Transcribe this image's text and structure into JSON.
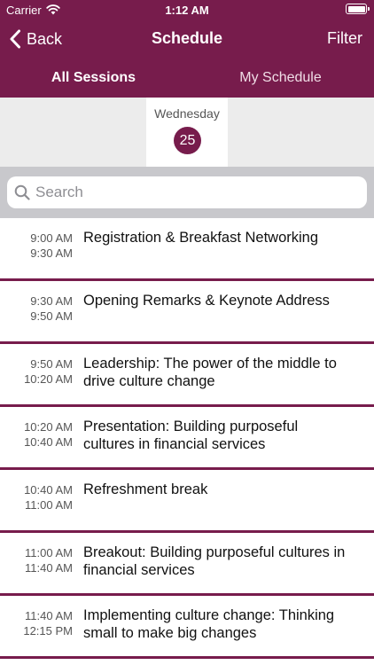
{
  "status_bar": {
    "carrier": "Carrier",
    "time": "1:12 AM"
  },
  "nav": {
    "back_label": "Back",
    "title": "Schedule",
    "filter_label": "Filter"
  },
  "tabs": [
    {
      "label": "All Sessions",
      "active": true
    },
    {
      "label": "My Schedule",
      "active": false
    }
  ],
  "day": {
    "weekday": "Wednesday",
    "date": "25"
  },
  "search": {
    "placeholder": "Search",
    "value": ""
  },
  "sessions": [
    {
      "start": "9:00 AM",
      "end": "9:30 AM",
      "title": "Registration & Breakfast Networking"
    },
    {
      "start": "9:30 AM",
      "end": "9:50 AM",
      "title": "Opening Remarks & Keynote Address"
    },
    {
      "start": "9:50 AM",
      "end": "10:20 AM",
      "title": "Leadership: The power of the middle to drive culture change"
    },
    {
      "start": "10:20 AM",
      "end": "10:40 AM",
      "title": "Presentation: Building purposeful cultures in financial services"
    },
    {
      "start": "10:40 AM",
      "end": "11:00 AM",
      "title": "Refreshment break"
    },
    {
      "start": "11:00 AM",
      "end": "11:40 AM",
      "title": "Breakout: Building purposeful cultures in financial services"
    },
    {
      "start": "11:40 AM",
      "end": "12:15 PM",
      "title": "Implementing culture change: Thinking small to make big changes"
    }
  ],
  "colors": {
    "brand": "#771c4c",
    "day_strip_bg": "#ececec",
    "search_area_bg": "#c8c8cc"
  },
  "icons": {
    "back": "chevron-left-icon",
    "search": "search-icon",
    "wifi": "wifi-icon",
    "battery": "battery-icon"
  }
}
